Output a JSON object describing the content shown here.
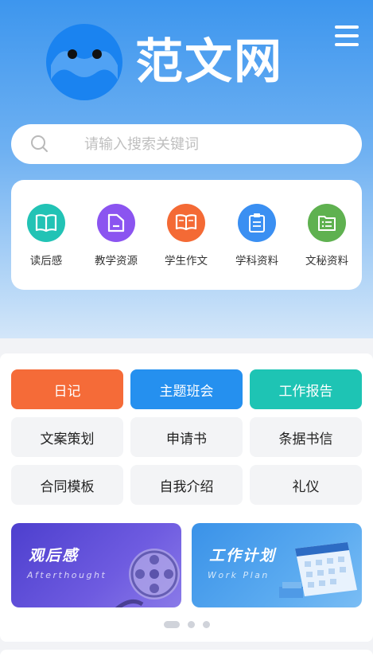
{
  "header": {
    "logo_text": "范文网",
    "brand_color": "#1a83f0"
  },
  "search": {
    "placeholder": "请输入搜索关键词"
  },
  "categories": [
    {
      "label": "读后感",
      "icon": "open-book-icon",
      "color": "#22c3b5"
    },
    {
      "label": "教学资源",
      "icon": "folder-icon",
      "color": "#8b54f0"
    },
    {
      "label": "学生作文",
      "icon": "book-icon",
      "color": "#f46a35"
    },
    {
      "label": "学科资料",
      "icon": "clipboard-icon",
      "color": "#3a8ff2"
    },
    {
      "label": "文秘资料",
      "icon": "document-list-icon",
      "color": "#5fb150"
    }
  ],
  "quick_links": [
    {
      "label": "日记",
      "color": "#f56b38"
    },
    {
      "label": "主题班会",
      "color": "#2590ef"
    },
    {
      "label": "工作报告",
      "color": "#1ec4b4"
    },
    {
      "label": "文案策划"
    },
    {
      "label": "申请书"
    },
    {
      "label": "条据书信"
    },
    {
      "label": "合同模板"
    },
    {
      "label": "自我介绍"
    },
    {
      "label": "礼仪"
    }
  ],
  "banners": [
    {
      "title": "观后感",
      "subtitle": "Afterthought"
    },
    {
      "title": "工作计划",
      "subtitle": "Work Plan"
    }
  ]
}
